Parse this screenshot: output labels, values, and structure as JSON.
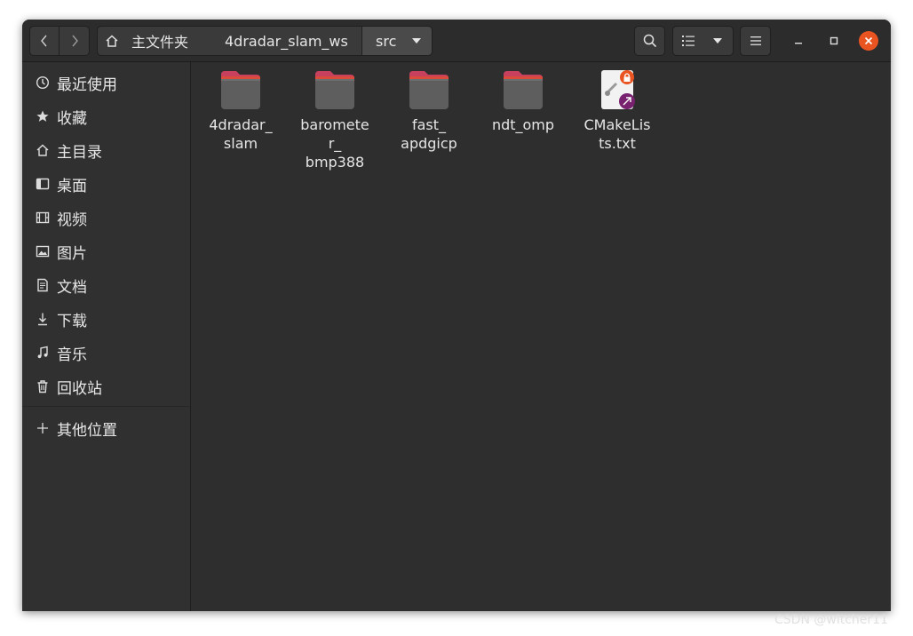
{
  "header": {
    "breadcrumbs": [
      {
        "label": "主文件夹",
        "icon": "home-icon"
      },
      {
        "label": "4dradar_slam_ws"
      },
      {
        "label": "src"
      }
    ]
  },
  "sidebar": {
    "items": [
      {
        "label": "最近使用",
        "icon": "clock-icon"
      },
      {
        "label": "收藏",
        "icon": "star-icon"
      },
      {
        "label": "主目录",
        "icon": "home-icon"
      },
      {
        "label": "桌面",
        "icon": "desktop-icon"
      },
      {
        "label": "视频",
        "icon": "film-icon"
      },
      {
        "label": "图片",
        "icon": "image-icon"
      },
      {
        "label": "文档",
        "icon": "document-icon"
      },
      {
        "label": "下载",
        "icon": "download-icon"
      },
      {
        "label": "音乐",
        "icon": "music-icon"
      },
      {
        "label": "回收站",
        "icon": "trash-icon"
      }
    ],
    "other_locations": {
      "label": "其他位置",
      "icon": "plus-icon"
    }
  },
  "files": [
    {
      "name": "4dradar_\nslam",
      "type": "folder"
    },
    {
      "name": "baromete\nr_\nbmp388",
      "type": "folder"
    },
    {
      "name": "fast_\napdgicp",
      "type": "folder"
    },
    {
      "name": "ndt_omp",
      "type": "folder"
    },
    {
      "name": "CMakeLis\nts.txt",
      "type": "symlink-locked-file"
    }
  ],
  "watermark": "CSDN @witcher11",
  "colors": {
    "accent_close": "#e95420",
    "folder_tab": "#c7405e",
    "folder_body": "#5e5e5e",
    "lock_badge": "#e95420",
    "link_badge": "#77216f"
  }
}
